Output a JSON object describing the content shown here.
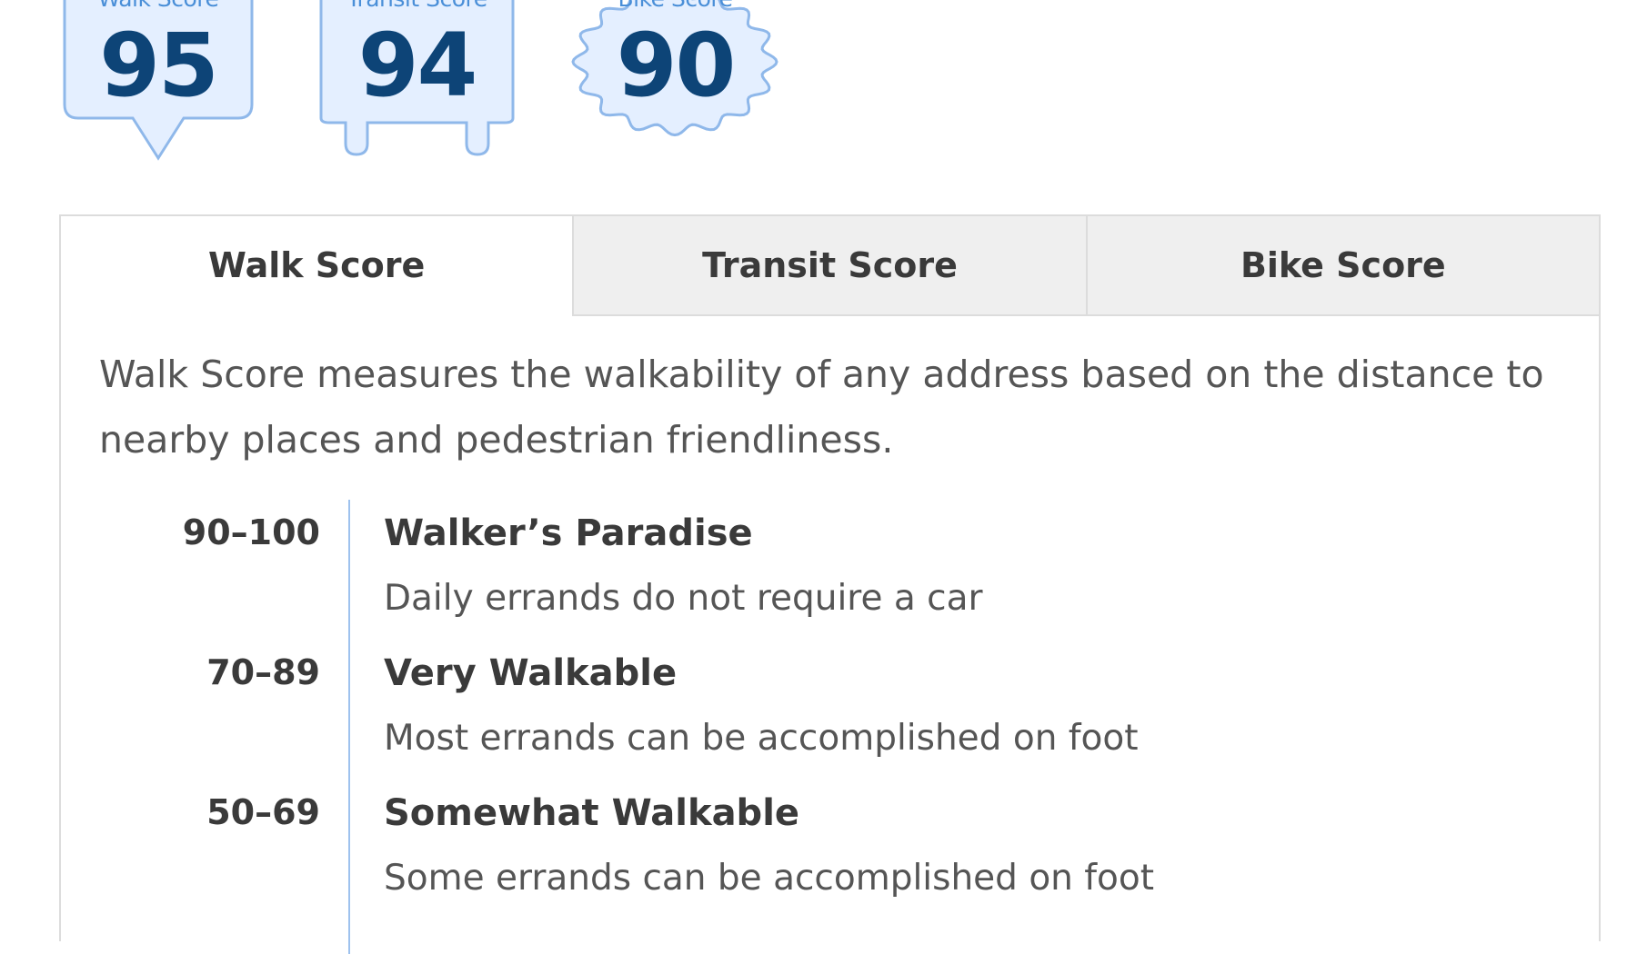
{
  "badges": [
    {
      "label": "Walk Score",
      "value": "95"
    },
    {
      "label": "Transit Score",
      "value": "94"
    },
    {
      "label": "Bike Score",
      "value": "90"
    }
  ],
  "tabs": [
    {
      "label": "Walk Score",
      "active": true
    },
    {
      "label": "Transit Score",
      "active": false
    },
    {
      "label": "Bike Score",
      "active": false
    }
  ],
  "walk_tab": {
    "description": "Walk Score measures the walkability of any address based on the distance to nearby places and pedestrian friendliness.",
    "ranges": [
      {
        "range": "90–100",
        "title": "Walker’s Paradise",
        "desc": "Daily errands do not require a car"
      },
      {
        "range": "70–89",
        "title": "Very Walkable",
        "desc": "Most errands can be accomplished on foot"
      },
      {
        "range": "50–69",
        "title": "Somewhat Walkable",
        "desc": "Some errands can be accomplished on foot"
      }
    ]
  },
  "colors": {
    "badge_fill": "#e4efff",
    "badge_stroke": "#8fb8ea",
    "badge_number": "#0d4477",
    "badge_label": "#4a8fd8",
    "divider": "#9ec2ee"
  }
}
